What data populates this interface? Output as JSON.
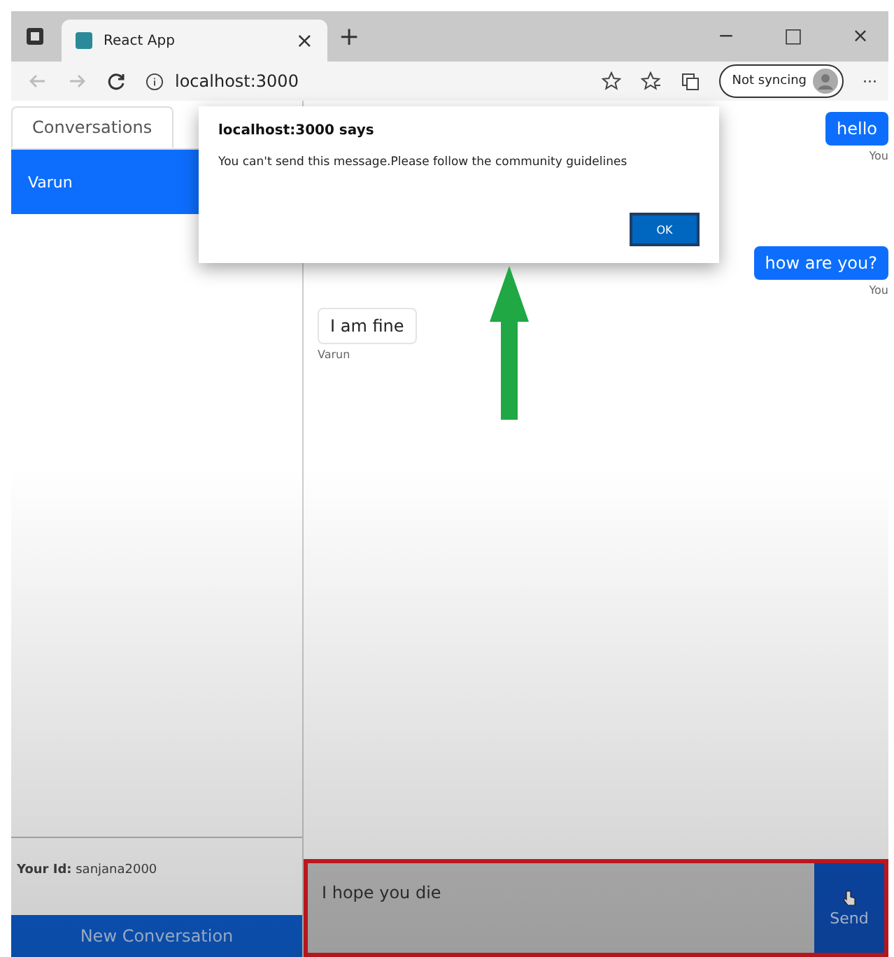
{
  "browser": {
    "tab_title": "React App",
    "close_tab": "×",
    "new_tab": "+",
    "address": "localhost:3000",
    "sync_label": "Not syncing",
    "more": "···",
    "minimize": "−",
    "maximize": "□",
    "close_window": "×"
  },
  "sidebar": {
    "tabs": [
      {
        "label": "Conversations",
        "selected": true
      }
    ],
    "conversations": [
      {
        "name": "Varun",
        "selected": true
      }
    ],
    "your_id": "**Your Id:** sanjana2000",
    "new_button": "New Conversation"
  },
  "messages": [
    {
      "text": "hello",
      "sender": "You",
      "mine": true
    },
    {
      "text": "how are you?",
      "sender": "You",
      "mine": true
    },
    {
      "text": "I am fine",
      "sender": "Varun",
      "mine": false
    }
  ],
  "composer": {
    "value": "I hope you die",
    "send": "Send",
    "highlighted": true
  },
  "alert": {
    "title": "localhost:3000 says",
    "message": "You can't send this message.Please follow the community guidelines",
    "ok": "OK"
  },
  "annotation": {
    "arrow": true
  }
}
